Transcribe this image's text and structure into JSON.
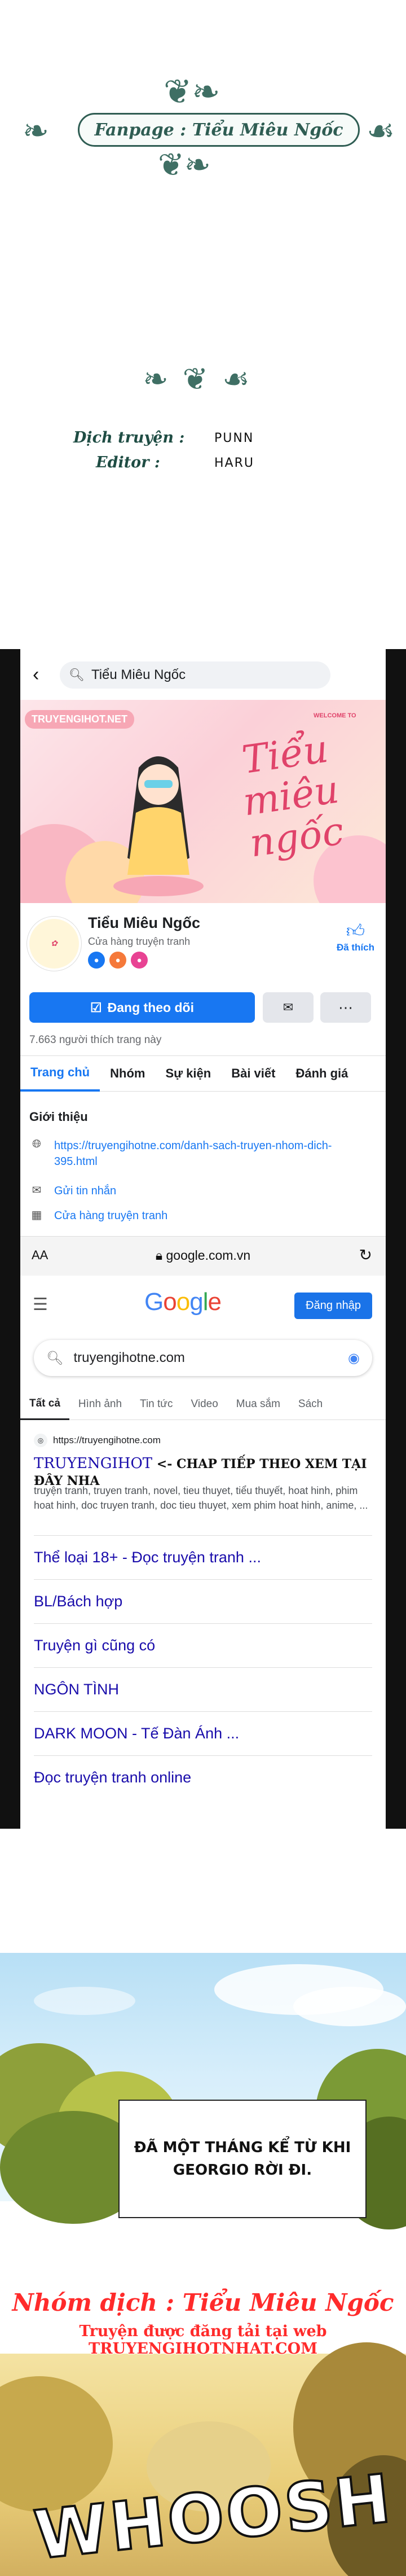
{
  "credits": {
    "fanpage": "Fanpage : Tiểu Miêu Ngốc",
    "translator_label": "Dịch truyện :",
    "translator_value": "PUNN",
    "editor_label": "Editor :",
    "editor_value": "HARU"
  },
  "facebook": {
    "search_text": "Tiểu Miêu Ngốc",
    "cover_logo": "TRUYENGIHOT.NET",
    "cover_welcome": "WELCOME TO",
    "cover_title": "Tiểu miêu ngốc",
    "page_name": "Tiểu Miêu Ngốc",
    "page_category": "Cửa hàng truyện tranh",
    "liked_label": "Đã thích",
    "follow_button": "Đang theo dõi",
    "likes_count": "7.663 người thích trang này",
    "tabs": [
      "Trang chủ",
      "Nhóm",
      "Sự kiện",
      "Bài viết",
      "Đánh giá"
    ],
    "intro_title": "Giới thiệu",
    "intro_items": [
      {
        "icon": "globe-icon",
        "text": "https://truyengihotne.com/danh-sach-truyen-nhom-dich-395.html"
      },
      {
        "icon": "messenger-icon",
        "text": "Gửi tin nhắn"
      },
      {
        "icon": "shop-icon",
        "text": "Cửa hàng truyện tranh"
      }
    ]
  },
  "safari": {
    "aa": "AA",
    "url": "google.com.vn"
  },
  "google": {
    "signin": "Đăng nhập",
    "query": "truyengihotne.com",
    "tabs": [
      "Tất cả",
      "Hình ảnh",
      "Tin tức",
      "Video",
      "Mua sắm",
      "Sách"
    ],
    "result_site": "https://truyengihotne.com",
    "result_title_main": "TRUYENGIHOT",
    "result_title_extra": " <- CHAP TIẾP THEO XEM TẠI ĐÂY NHA",
    "result_snippet": "truyện tranh, truyen tranh, novel, tieu thuyet, tiểu thuyết, hoat hinh, phim hoat hinh, doc truyen tranh, doc tieu thuyet, xem phim hoat hinh, anime, ...",
    "sitelinks": [
      "Thể loại 18+ - Đọc truyện tranh ...",
      "BL/Bách hợp",
      "Truyện gì cũng có",
      "NGÔN TÌNH",
      "DARK MOON - Tế Đàn Ánh ...",
      "Đọc truyện tranh online"
    ]
  },
  "comic": {
    "narration": "ĐÃ MỘT THÁNG KỂ TỪ KHI GEORGIO RỜI ĐI.",
    "group_name": "Nhóm dịch : Tiểu Miêu Ngốc",
    "group_site": "Truyện được đăng tải tại web TRUYENGIHOTNHAT.COM",
    "sfx": "WHOOSH"
  },
  "colors": {
    "facebook_blue": "#1877f2",
    "credit_green": "#2f5d53",
    "watermark_red": "#ff2b2b"
  }
}
